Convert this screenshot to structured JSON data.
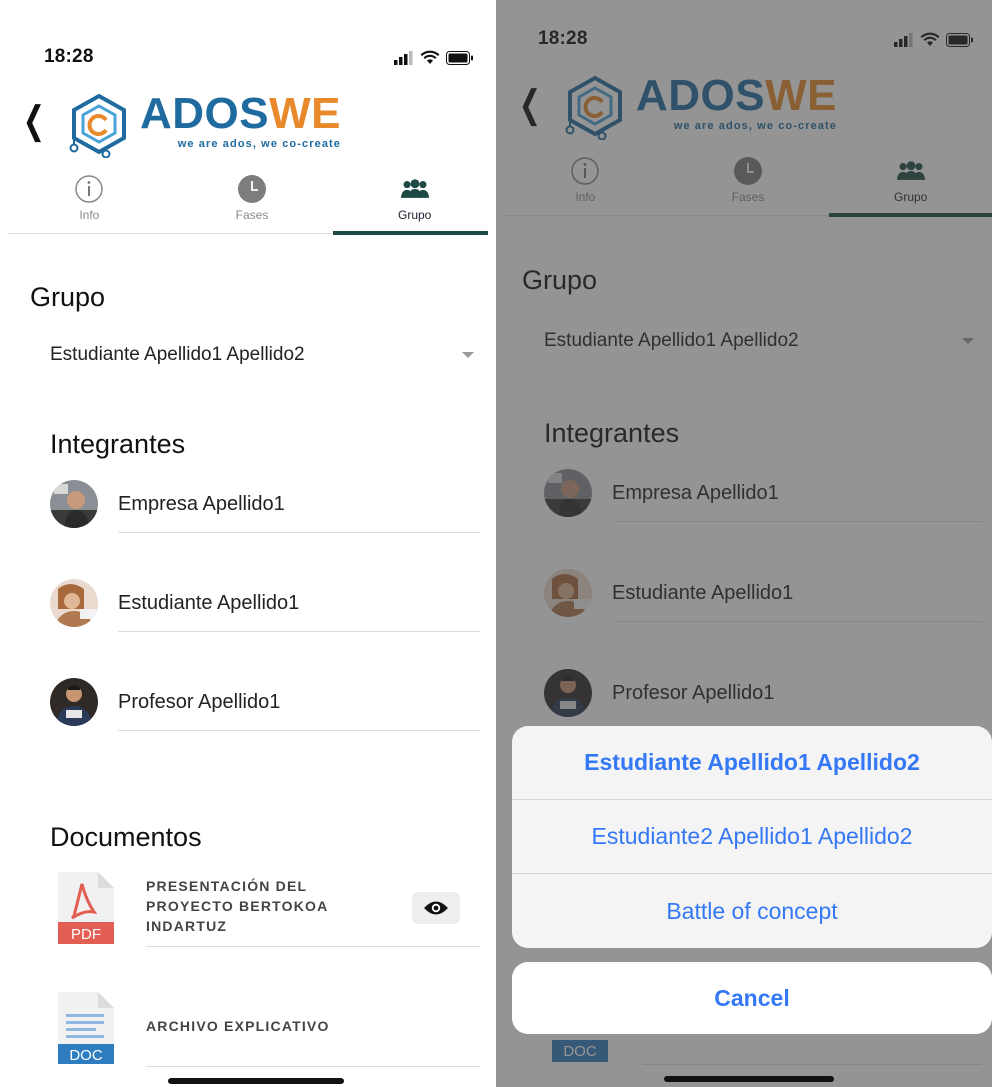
{
  "status": {
    "time": "18:28"
  },
  "logo": {
    "word_a": "ADOS",
    "word_b": "WE",
    "tagline": "we are ados, we co-create"
  },
  "tabs": [
    {
      "label": "Info",
      "icon": "info-icon"
    },
    {
      "label": "Fases",
      "icon": "clock-icon"
    },
    {
      "label": "Grupo",
      "icon": "group-icon",
      "active": true
    }
  ],
  "grupo": {
    "title": "Grupo",
    "selected": "Estudiante Apellido1 Apellido2"
  },
  "integrantes": {
    "title": "Integrantes",
    "members": [
      {
        "name": "Empresa Apellido1"
      },
      {
        "name": "Estudiante Apellido1"
      },
      {
        "name": "Profesor Apellido1"
      }
    ]
  },
  "documentos": {
    "title": "Documentos",
    "items": [
      {
        "type": "PDF",
        "title_lines": [
          "PRESENTACIÓN DEL",
          "PROYECTO BERTOKOA",
          "INDARTUZ"
        ],
        "icon": "pdf-file-icon"
      },
      {
        "type": "DOC",
        "title_lines": [
          "ARCHIVO EXPLICATIVO"
        ],
        "icon": "doc-file-icon"
      }
    ]
  },
  "action_sheet": {
    "options": [
      {
        "label": "Estudiante Apellido1 Apellido2",
        "selected": true
      },
      {
        "label": "Estudiante2 Apellido1 Apellido2"
      },
      {
        "label": "Battle of concept"
      }
    ],
    "cancel": "Cancel"
  },
  "colors": {
    "brand_blue": "#1f6ba0",
    "brand_orange": "#e8892b",
    "tab_indicator": "#1e4a46",
    "ios_blue": "#3478f6"
  }
}
